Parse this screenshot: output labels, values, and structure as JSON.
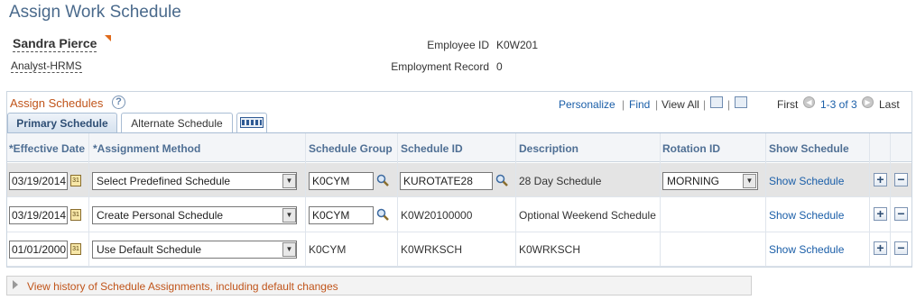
{
  "page": {
    "title": "Assign Work Schedule"
  },
  "employee": {
    "name": "Sandra Pierce",
    "job_title": "Analyst-HRMS",
    "id_label": "Employee ID",
    "id_value": "K0W201",
    "record_label": "Employment Record",
    "record_value": "0"
  },
  "grid": {
    "title": "Assign Schedules",
    "help_glyph": "?",
    "personalize": "Personalize",
    "find": "Find",
    "view_all": "View All",
    "sep": "|",
    "first": "First",
    "range": "1-3 of 3",
    "last": "Last",
    "tabs": {
      "primary": "Primary Schedule",
      "alternate": "Alternate Schedule"
    },
    "columns": {
      "effective_date": "*Effective Date",
      "assignment_method": "*Assignment Method",
      "schedule_group": "Schedule Group",
      "schedule_id": "Schedule ID",
      "description": "Description",
      "rotation_id": "Rotation ID",
      "show_schedule": "Show Schedule"
    },
    "rows": [
      {
        "date": "03/19/2014",
        "method": "Select Predefined Schedule",
        "group": "K0CYM",
        "schedule_id": "KUROTATE28",
        "description": "28 Day Schedule",
        "rotation": "MORNING",
        "show": "Show Schedule"
      },
      {
        "date": "03/19/2014",
        "method": "Create Personal Schedule",
        "group": "K0CYM",
        "schedule_id": "K0W20100000",
        "description": "Optional Weekend Schedule",
        "rotation": "",
        "show": "Show Schedule"
      },
      {
        "date": "01/01/2000",
        "method": "Use Default Schedule",
        "group": "K0CYM",
        "schedule_id": "K0WRKSCH",
        "description": "K0WRKSCH",
        "rotation": "",
        "show": "Show Schedule"
      }
    ],
    "cal_glyph": "31",
    "plus": "+",
    "minus": "−"
  },
  "history": {
    "label": "View history of Schedule Assignments, including default changes"
  },
  "colors": {
    "title": "#4a6a8c",
    "link": "#1a5ea8",
    "accent": "#c0541a",
    "header": "#4f6f94"
  }
}
